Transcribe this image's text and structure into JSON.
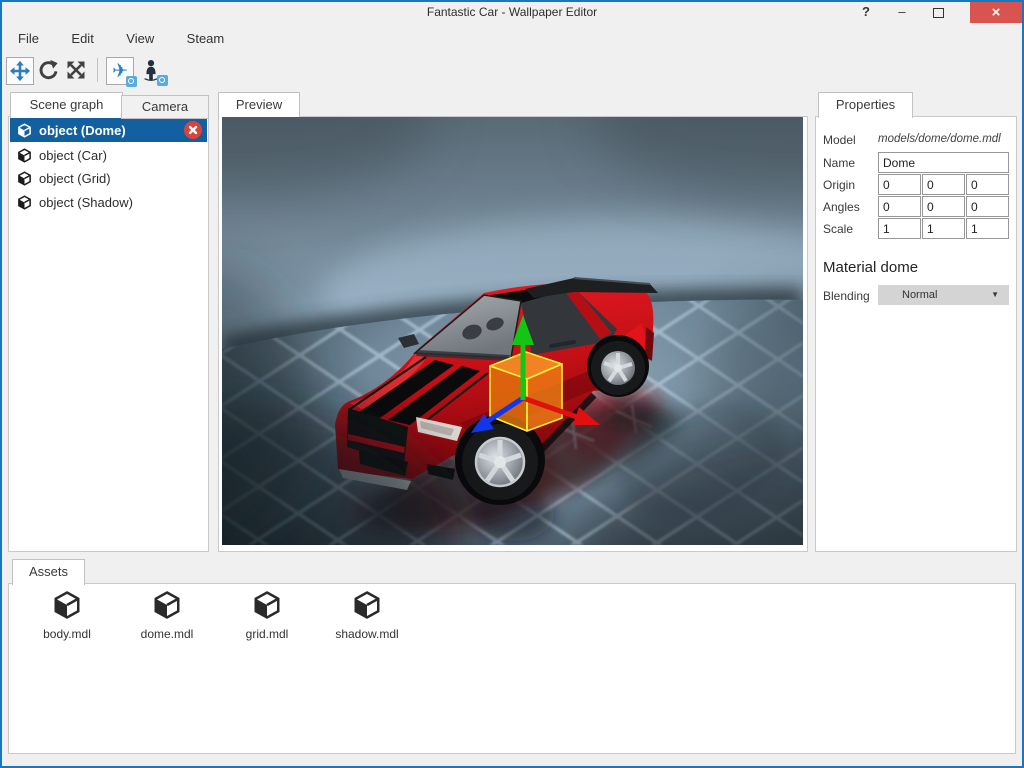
{
  "window": {
    "title": "Fantastic Car - Wallpaper Editor",
    "controls": {
      "help": "?",
      "minimize": "–",
      "close": "×"
    }
  },
  "menu": {
    "items": [
      {
        "label": "File"
      },
      {
        "label": "Edit"
      },
      {
        "label": "View"
      },
      {
        "label": "Steam"
      }
    ]
  },
  "toolbar": {
    "tools": [
      {
        "icon": "move-tool-icon",
        "active": true
      },
      {
        "icon": "rotate-tool-icon",
        "active": false
      },
      {
        "icon": "scale-tool-icon",
        "active": false
      },
      {
        "icon": "airplane-tool-icon",
        "active": true
      },
      {
        "icon": "person-tool-icon",
        "active": false
      }
    ]
  },
  "scene_graph": {
    "tabs": [
      {
        "label": "Scene graph",
        "active": true
      },
      {
        "label": "Camera",
        "active": false
      }
    ],
    "items": [
      {
        "label": "object (Dome)",
        "selected": true
      },
      {
        "label": "object (Car)",
        "selected": false
      },
      {
        "label": "object (Grid)",
        "selected": false
      },
      {
        "label": "object (Shadow)",
        "selected": false
      }
    ]
  },
  "preview": {
    "tab_label": "Preview"
  },
  "properties": {
    "tab_label": "Properties",
    "model_label": "Model",
    "model_value": "models/dome/dome.mdl",
    "name_label": "Name",
    "name_value": "Dome",
    "origin_label": "Origin",
    "origin": [
      "0",
      "0",
      "0"
    ],
    "angles_label": "Angles",
    "angles": [
      "0",
      "0",
      "0"
    ],
    "scale_label": "Scale",
    "scale": [
      "1",
      "1",
      "1"
    ],
    "material_heading": "Material dome",
    "blending_label": "Blending",
    "blending_value": "Normal"
  },
  "assets": {
    "tab_label": "Assets",
    "items": [
      {
        "label": "body.mdl"
      },
      {
        "label": "dome.mdl"
      },
      {
        "label": "grid.mdl"
      },
      {
        "label": "shadow.mdl"
      }
    ]
  },
  "colors": {
    "accent_border": "#1778c2",
    "selection_blue": "#12609f",
    "close_red": "#d9534f",
    "delete_red": "#d9433c",
    "tool_blue": "#2b7cc2",
    "gizmo_x": "#e01010",
    "gizmo_y": "#14c614",
    "gizmo_z": "#1236e8"
  }
}
